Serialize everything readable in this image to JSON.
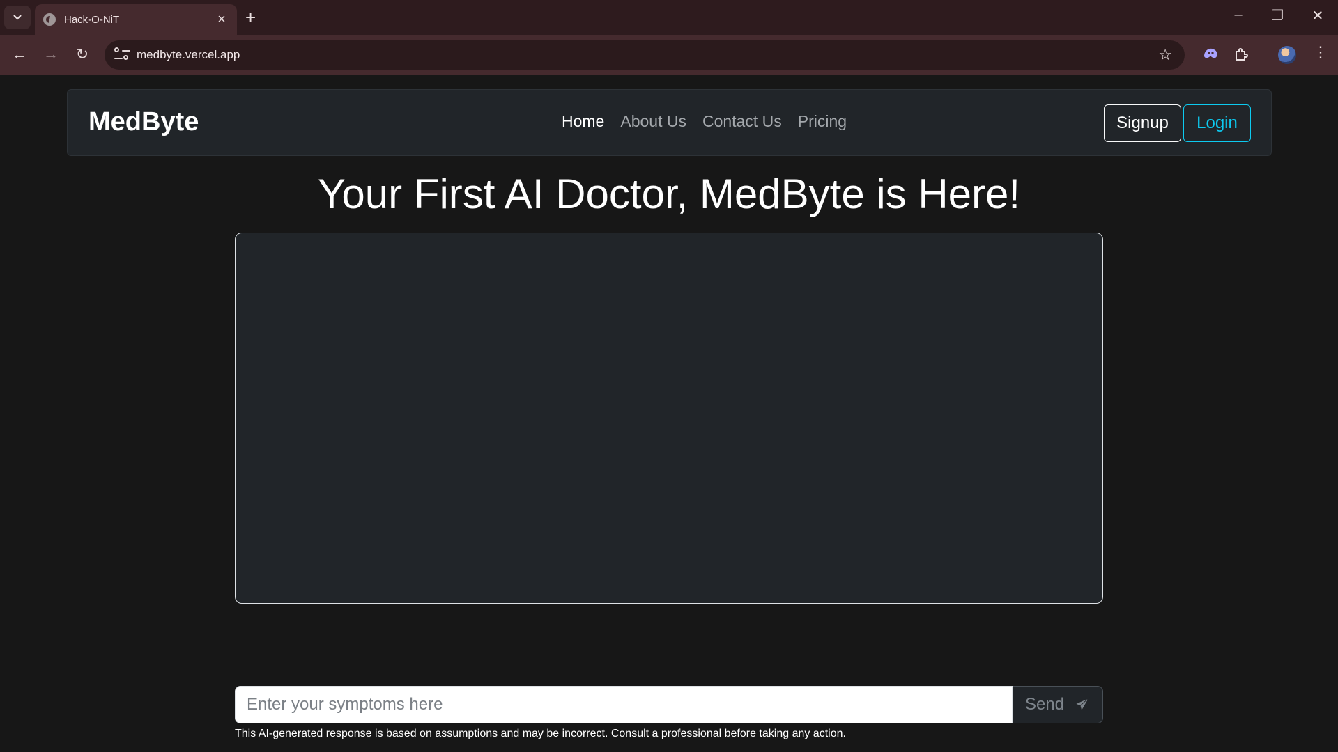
{
  "browser": {
    "tab_title": "Hack-O-NiT",
    "url": "medbyte.vercel.app"
  },
  "navbar": {
    "brand": "MedByte",
    "links": [
      {
        "label": "Home",
        "active": true
      },
      {
        "label": "About Us",
        "active": false
      },
      {
        "label": "Contact Us",
        "active": false
      },
      {
        "label": "Pricing",
        "active": false
      }
    ],
    "signup_label": "Signup",
    "login_label": "Login"
  },
  "main": {
    "headline": "Your First AI Doctor, MedByte is Here!",
    "chat_messages": []
  },
  "composer": {
    "placeholder": "Enter your symptoms here",
    "value": "",
    "send_label": "Send",
    "disclaimer": "This AI-generated response is based on assumptions and may be incorrect. Consult a professional before taking any action."
  },
  "colors": {
    "page_bg": "#171717",
    "card_bg": "#212529",
    "login_accent": "#0dcaf0",
    "browser_frame": "#452a2e"
  },
  "icons": [
    "tab-list-icon",
    "globe-icon",
    "close-icon",
    "plus-icon",
    "minimize-icon",
    "restore-icon",
    "back-arrow-icon",
    "forward-arrow-icon",
    "reload-icon",
    "site-settings-icon",
    "star-icon",
    "gemini-icon",
    "extensions-icon",
    "profile-avatar-icon",
    "more-menu-icon",
    "send-paper-plane-icon"
  ]
}
